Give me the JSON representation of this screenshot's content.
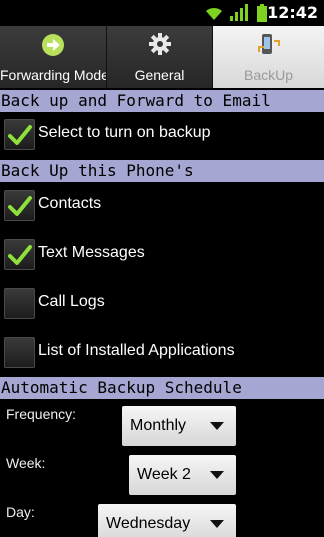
{
  "status_bar": {
    "time": "12:42"
  },
  "tabs": [
    {
      "label": "Forwarding Mode",
      "icon": "arrow-right-icon"
    },
    {
      "label": "General",
      "icon": "gear-icon"
    },
    {
      "label": "BackUp",
      "icon": "backup-icon"
    }
  ],
  "active_tab": "BackUp",
  "sections": {
    "backup_forward": {
      "title": "Back up and Forward to Email",
      "toggle": {
        "label": "Select to turn on backup",
        "checked": true
      }
    },
    "backup_phone": {
      "title": "Back Up this Phone's",
      "items": [
        {
          "label": "Contacts",
          "checked": true
        },
        {
          "label": "Text Messages",
          "checked": true
        },
        {
          "label": "Call Logs",
          "checked": false
        },
        {
          "label": "List of Installed Applications",
          "checked": false
        }
      ]
    },
    "schedule": {
      "title": "Automatic Backup Schedule",
      "frequency": {
        "label": "Frequency:",
        "value": "Monthly"
      },
      "week": {
        "label": "Week:",
        "value": "Week 2"
      },
      "day": {
        "label": "Day:",
        "value": "Wednesday"
      }
    }
  },
  "colors": {
    "section_header": "#a6a6d2",
    "check": "#8ee03a"
  }
}
